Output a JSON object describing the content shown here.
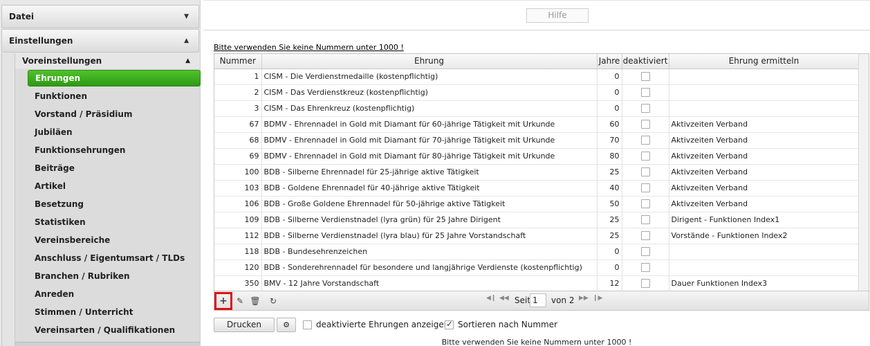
{
  "sidebar": {
    "datei": "Datei",
    "einstellungen": "Einstellungen",
    "voreinstellungen": "Voreinstellungen",
    "items": [
      {
        "label": "Ehrungen",
        "active": true
      },
      {
        "label": "Funktionen"
      },
      {
        "label": "Vorstand / Präsidium"
      },
      {
        "label": "Jubiläen"
      },
      {
        "label": "Funktionsehrungen"
      },
      {
        "label": "Beiträge"
      },
      {
        "label": "Artikel"
      },
      {
        "label": "Besetzung"
      },
      {
        "label": "Statistiken"
      },
      {
        "label": "Vereinsbereiche"
      },
      {
        "label": "Anschluss / Eigentumsart / TLDs"
      },
      {
        "label": "Branchen / Rubriken"
      },
      {
        "label": "Anreden"
      },
      {
        "label": "Stimmen / Unterricht"
      },
      {
        "label": "Vereinsarten / Qualifikationen"
      }
    ]
  },
  "topbar": {
    "help": "Hilfe"
  },
  "warning": "Bitte verwenden Sie keine Nummern unter 1000 !",
  "table": {
    "columns": [
      "Nummer",
      "Ehrung",
      "Jahre",
      "deaktiviert",
      "Ehrung ermitteln"
    ],
    "rows": [
      {
        "nummer": "1",
        "ehrung": "CISM - Die Verdienstmedaille (kostenpflichtig)",
        "jahre": "0",
        "ermitteln": ""
      },
      {
        "nummer": "2",
        "ehrung": "CISM - Das Verdienstkreuz (kostenpflichtig)",
        "jahre": "0",
        "ermitteln": ""
      },
      {
        "nummer": "3",
        "ehrung": "CISM - Das Ehrenkreuz (kostenpflichtig)",
        "jahre": "0",
        "ermitteln": ""
      },
      {
        "nummer": "67",
        "ehrung": "BDMV - Ehrennadel in Gold mit Diamant für 60-jährige Tätigkeit mit Urkunde",
        "jahre": "60",
        "ermitteln": "Aktivzeiten Verband"
      },
      {
        "nummer": "68",
        "ehrung": "BDMV - Ehrennadel in Gold mit Diamant für 70-jährige Tätigkeit mit Urkunde",
        "jahre": "70",
        "ermitteln": "Aktivzeiten Verband"
      },
      {
        "nummer": "69",
        "ehrung": "BDMV - Ehrennadel in Gold mit Diamant für 80-jährige Tätigkeit mit Urkunde",
        "jahre": "80",
        "ermitteln": "Aktivzeiten Verband"
      },
      {
        "nummer": "100",
        "ehrung": "BDB - Silberne Ehrennadel für 25-jährige aktive Tätigkeit",
        "jahre": "25",
        "ermitteln": "Aktivzeiten Verband"
      },
      {
        "nummer": "103",
        "ehrung": "BDB - Goldene Ehrennadel für 40-jährige aktive Tätigkeit",
        "jahre": "40",
        "ermitteln": "Aktivzeiten Verband"
      },
      {
        "nummer": "106",
        "ehrung": "BDB - Große Goldene Ehrennadel für 50-jährige aktive Tätigkeit",
        "jahre": "50",
        "ermitteln": "Aktivzeiten Verband"
      },
      {
        "nummer": "109",
        "ehrung": "BDB - Silberne Verdienstnadel (lyra grün) für 25 Jahre Dirigent",
        "jahre": "25",
        "ermitteln": "Dirigent - Funktionen Index1"
      },
      {
        "nummer": "112",
        "ehrung": "BDB - Silberne Verdienstnadel (lyra blau) für 25 Jahre Vorstandschaft",
        "jahre": "25",
        "ermitteln": "Vorstände - Funktionen Index2"
      },
      {
        "nummer": "118",
        "ehrung": "BDB - Bundesehrenzeichen",
        "jahre": "0",
        "ermitteln": ""
      },
      {
        "nummer": "120",
        "ehrung": "BDB - Sonderehrennadel für besondere und langjährige Verdienste (kostenpflichtig)",
        "jahre": "0",
        "ermitteln": ""
      },
      {
        "nummer": "350",
        "ehrung": "BMV - 12 Jahre Vorstandschaft",
        "jahre": "12",
        "ermitteln": "Dauer Funktionen Index3"
      }
    ]
  },
  "pager": {
    "seite": "Seite",
    "page": "1",
    "von": "von 2"
  },
  "bottom": {
    "drucken": "Drucken",
    "show_deactivated": "deaktivierte Ehrungen anzeigen",
    "sort_by_number": "Sortieren nach Nummer",
    "note": "Bitte verwenden Sie keine Nummern unter 1000 !"
  }
}
